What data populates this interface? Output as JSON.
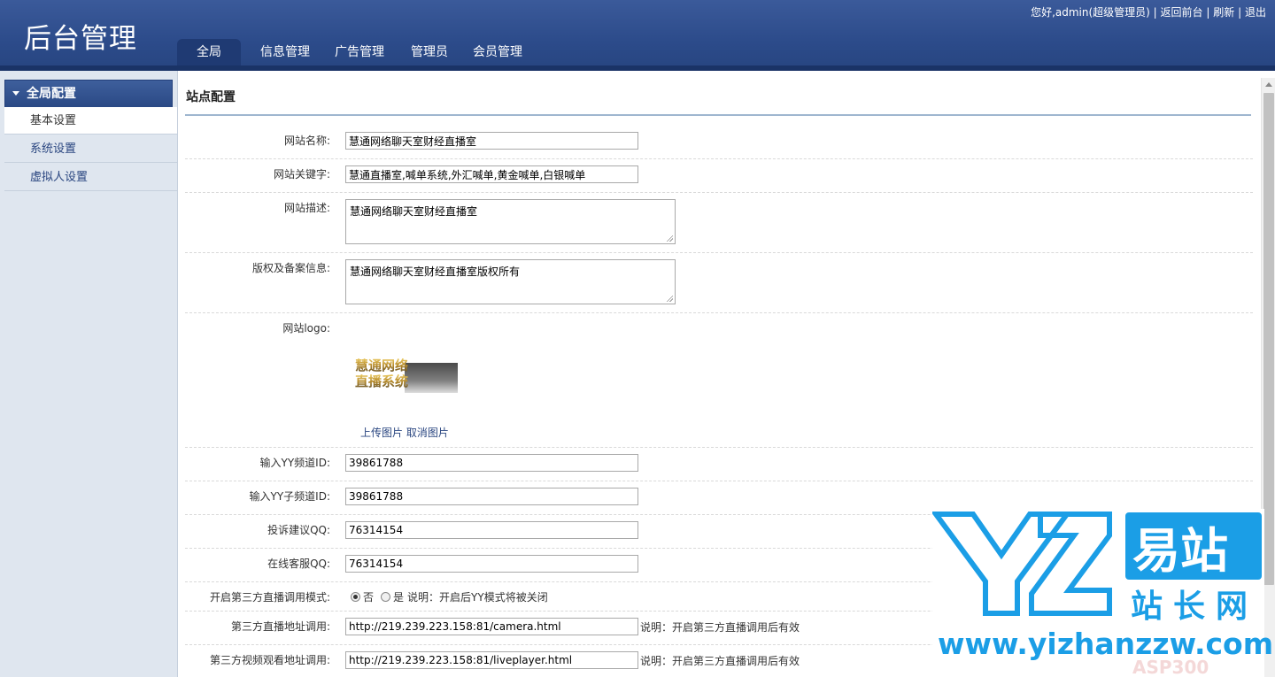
{
  "app": {
    "title": "后台管理"
  },
  "topbar": {
    "greeting": "您好,admin(超级管理员)",
    "links": [
      "返回前台",
      "刷新",
      "退出"
    ]
  },
  "nav": {
    "tabs": [
      {
        "label": "全局",
        "active": true
      },
      {
        "label": "信息管理",
        "active": false
      },
      {
        "label": "广告管理",
        "active": false
      },
      {
        "label": "管理员",
        "active": false
      },
      {
        "label": "会员管理",
        "active": false
      }
    ]
  },
  "sidebar": {
    "heading": "全局配置",
    "items": [
      {
        "label": "基本设置",
        "active": true
      },
      {
        "label": "系统设置",
        "active": false
      },
      {
        "label": "虚拟人设置",
        "active": false
      }
    ]
  },
  "main": {
    "section_title": "站点配置",
    "fields": {
      "site_name": {
        "label": "网站名称:",
        "value": "慧通网络聊天室财经直播室"
      },
      "keywords": {
        "label": "网站关键字:",
        "value": "慧通直播室,喊单系统,外汇喊单,黄金喊单,白银喊单"
      },
      "description": {
        "label": "网站描述:",
        "value": "慧通网络聊天室财经直播室"
      },
      "copyright": {
        "label": "版权及备案信息:",
        "value": "慧通网络聊天室财经直播室版权所有"
      },
      "logo": {
        "label": "网站logo:",
        "image_text_line1": "慧通网络",
        "image_text_line2": "直播系统",
        "upload_label": "上传图片",
        "cancel_label": "取消图片"
      },
      "yy_channel": {
        "label": "输入YY频道ID:",
        "value": "39861788"
      },
      "yy_sub_channel": {
        "label": "输入YY子频道ID:",
        "value": "39861788"
      },
      "complaint_qq": {
        "label": "投诉建议QQ:",
        "value": "76314154"
      },
      "service_qq": {
        "label": "在线客服QQ:",
        "value": "76314154"
      },
      "third_party_mode": {
        "label": "开启第三方直播调用模式:",
        "option_no": "否",
        "option_yes": "是",
        "selected": "否",
        "note": "说明：开启后YY模式将被关闭"
      },
      "live_url": {
        "label": "第三方直播地址调用:",
        "value": "http://219.239.223.158:81/camera.html",
        "note": "说明：开启第三方直播调用后有效"
      },
      "video_url": {
        "label": "第三方视频观看地址调用:",
        "value": "http://219.239.223.158:81/liveplayer.html",
        "note": "说明：开启第三方直播调用后有效"
      }
    }
  },
  "watermark": {
    "cn_top": "易站",
    "cn_bottom": "站长网",
    "url": "www.yizhanzzw.com",
    "faint": "ASP300"
  },
  "colors": {
    "header": "#2c4b8a",
    "sidebar": "#dfe6ef",
    "watermark_blue": "#1b9ee6"
  }
}
